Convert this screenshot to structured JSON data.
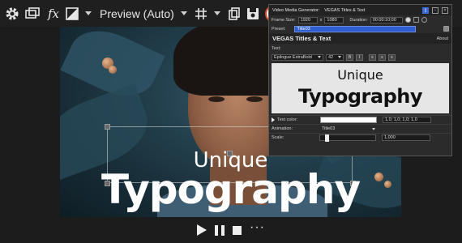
{
  "toolbar": {
    "preview_mode": "Preview (Auto)",
    "fx_label": "fx",
    "record_label": "V"
  },
  "canvas": {
    "text_line1": "Unique",
    "text_line2": "Typography"
  },
  "playback": {
    "more_label": "···"
  },
  "plugin": {
    "window_title": "Video Media Generator:",
    "window_subtitle": "VEGAS Titles & Text",
    "frame_size_label": "Frame Size:",
    "frame_width": "1920",
    "frame_x": "x",
    "frame_height": "1080",
    "duration_label": "Duration:",
    "duration_value": "00:00:10;00",
    "preset_label": "Preset:",
    "preset_value": "Title03",
    "section_title": "VEGAS Titles & Text",
    "about_label": "About",
    "text_label": "Text:",
    "font_name": "Epilogue ExtraBold",
    "font_size": "42",
    "preview_line1": "Unique",
    "preview_line2": "Typography",
    "text_color_label": "Text color:",
    "text_color_value": "1,0; 1,0; 1,0; 1,0",
    "text_color_hex": "#ffffff",
    "animation_label": "Animation:",
    "animation_value": "Title03",
    "scale_label": "Scale:",
    "scale_value": "1,000"
  }
}
